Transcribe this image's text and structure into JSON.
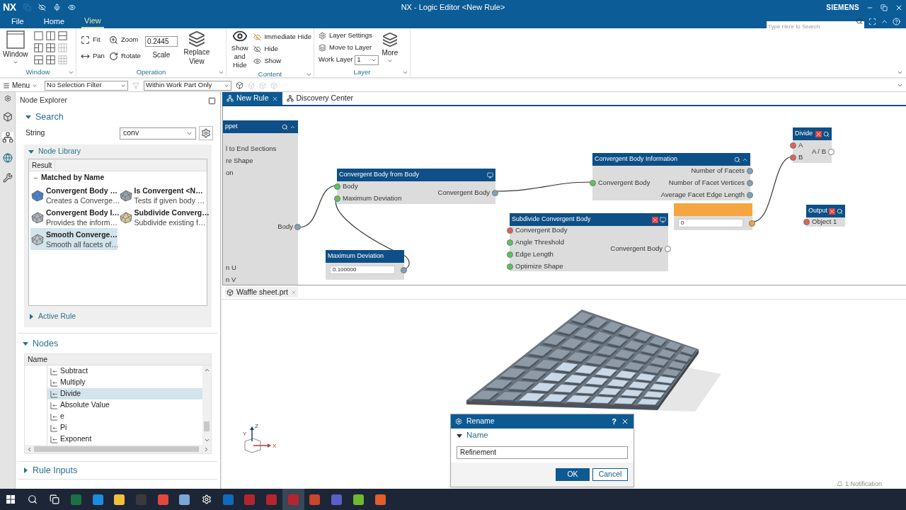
{
  "window": {
    "app": "NX",
    "title": "NX - Logic Editor <New Rule>",
    "brand": "SIEMENS",
    "search_placeholder": "Type Here to Search"
  },
  "menu_tabs": [
    {
      "label": "File",
      "selected": false
    },
    {
      "label": "Home",
      "selected": false
    },
    {
      "label": "View",
      "selected": true
    }
  ],
  "ribbon": {
    "window_group": {
      "label": "Window",
      "button": "Window"
    },
    "operation_group": {
      "label": "Operation",
      "fit": "Fit",
      "pan": "Pan",
      "zoom": "Zoom",
      "rotate": "Rotate",
      "scale_value": "0.2445",
      "scale_label": "Scale",
      "replace_view": "Replace View"
    },
    "content_group": {
      "label": "Content",
      "show_and_hide": "Show and Hide",
      "immediate_hide": "Immediate Hide",
      "hide": "Hide",
      "show": "Show"
    },
    "layer_group": {
      "label": "Layer",
      "layer_settings": "Layer Settings",
      "move_to_layer": "Move to Layer",
      "work_layer_label": "Work Layer",
      "work_layer_value": "1",
      "more": "More"
    }
  },
  "toolbar": {
    "menu": "Menu",
    "selection_filter": "No Selection Filter",
    "scope": "Within Work Part Only"
  },
  "node_explorer": {
    "title": "Node Explorer",
    "search": {
      "title": "Search",
      "expanded": true,
      "string_label": "String",
      "string_value": "conv"
    },
    "node_library": {
      "title": "Node Library",
      "expanded": true,
      "column": "Result",
      "group": "Matched by Name",
      "group_expanded": true,
      "results": [
        {
          "title": "Convergent Body …",
          "description": "Creates a Converge…",
          "selected": false
        },
        {
          "title": "Is Convergent <N…",
          "description": "Tests if given body …",
          "selected": false
        },
        {
          "title": "Convergent Body I…",
          "description": "Provides the inform…",
          "selected": false
        },
        {
          "title": "Subdivide Converg…",
          "description": "Subdivide existing f…",
          "selected": false
        },
        {
          "title": "Smooth Converge…",
          "description": "Smooth all facets of…",
          "selected": true
        }
      ]
    },
    "active_rule": {
      "title": "Active Rule",
      "expanded": false
    },
    "nodes": {
      "title": "Nodes",
      "expanded": true,
      "column": "Name",
      "items": [
        {
          "label": "Subtract",
          "selected": false
        },
        {
          "label": "Multiply",
          "selected": false
        },
        {
          "label": "Divide",
          "selected": true
        },
        {
          "label": "Absolute Value",
          "selected": false
        },
        {
          "label": "e",
          "selected": false
        },
        {
          "label": "Pi",
          "selected": false
        },
        {
          "label": "Exponent",
          "selected": false
        }
      ]
    },
    "rule_inputs": {
      "title": "Rule Inputs",
      "expanded": false
    }
  },
  "editor_tabs": [
    {
      "label": "New Rule",
      "selected": true
    },
    {
      "label": "Discovery Center",
      "selected": false
    }
  ],
  "graph": {
    "nodes": [
      {
        "kind": "clipped",
        "title": "ppet",
        "selected": false,
        "rows": [
          {
            "label": "l to End Sections",
            "kind": "input"
          },
          {
            "label": "re Shape",
            "kind": "input"
          },
          {
            "label": "on",
            "kind": "input"
          },
          {
            "label": "Body",
            "kind": "output"
          },
          {
            "label": "n U",
            "kind": "input"
          },
          {
            "label": "n V",
            "kind": "input"
          }
        ]
      },
      {
        "kind": "function",
        "title": "Convergent Body from Body",
        "selected": false,
        "inputs": [
          {
            "label": "Body",
            "kind": "ok"
          },
          {
            "label": "Maximum Deviation",
            "kind": "ok"
          }
        ],
        "outputs": [
          {
            "label": "Convergent Body",
            "kind": "out"
          }
        ]
      },
      {
        "kind": "value",
        "title": "Maximum Deviation",
        "selected": false,
        "value": "0.100000"
      },
      {
        "kind": "function",
        "title": "Convergent Body Information",
        "selected": false,
        "inputs": [
          {
            "label": "Convergent Body",
            "kind": "ok"
          }
        ],
        "outputs": [
          {
            "label": "Number of Facets",
            "kind": "out"
          },
          {
            "label": "Number of Facet Vertices",
            "kind": "out"
          },
          {
            "label": "Average Facet Edge Length",
            "kind": "out"
          }
        ]
      },
      {
        "kind": "function",
        "title": "Subdivide Convergent Body",
        "selected": false,
        "inputs": [
          {
            "label": "Convergent Body",
            "kind": "missing"
          },
          {
            "label": "Angle Threshold",
            "kind": "ok"
          },
          {
            "label": "Edge Length",
            "kind": "ok"
          },
          {
            "label": "Optimize Shape",
            "kind": "ok"
          }
        ],
        "outputs": [
          {
            "label": "Convergent Body",
            "kind": "open"
          }
        ]
      },
      {
        "kind": "value",
        "selected": true,
        "value": "0"
      },
      {
        "kind": "function",
        "title": "Divide",
        "selected": false,
        "inputs": [
          {
            "label": "A",
            "kind": "missing"
          },
          {
            "label": "B",
            "kind": "missing"
          }
        ],
        "outputs": [
          {
            "label": "A / B",
            "kind": "open"
          }
        ]
      },
      {
        "kind": "function",
        "title": "Output",
        "selected": false,
        "inputs": [
          {
            "label": "Object 1",
            "kind": "missing"
          }
        ]
      }
    ]
  },
  "viewport": {
    "tab": "Waffle sheet.prt",
    "axes": {
      "x": "X",
      "y": "Y",
      "z": "Z"
    },
    "notification": "1 Notification"
  },
  "dialog": {
    "title": "Rename",
    "help": "?",
    "section": "Name",
    "section_expanded": true,
    "value": "Refinement",
    "ok": "OK",
    "cancel": "Cancel"
  },
  "taskbar": [
    {
      "kind": "start",
      "selected": false
    },
    {
      "kind": "search",
      "selected": false
    },
    {
      "kind": "taskview",
      "selected": false
    },
    {
      "kind": "app",
      "color": "#1d7044",
      "selected": false
    },
    {
      "kind": "app",
      "color": "#1e8be0",
      "selected": false
    },
    {
      "kind": "app",
      "color": "#f0c03a",
      "selected": false
    },
    {
      "kind": "app",
      "color": "#3a3a3a",
      "selected": false
    },
    {
      "kind": "app",
      "color": "#e2483d",
      "selected": false
    },
    {
      "kind": "app",
      "color": "#7aa8d8",
      "selected": false
    },
    {
      "kind": "settings",
      "selected": false
    },
    {
      "kind": "app",
      "color": "#0f6cbd",
      "selected": false
    },
    {
      "kind": "app",
      "color": "#b3262e",
      "selected": false
    },
    {
      "kind": "app",
      "color": "#b3262e",
      "selected": false
    },
    {
      "kind": "app",
      "color": "#b3262e",
      "selected": true
    },
    {
      "kind": "app",
      "color": "#c8462b",
      "selected": false
    },
    {
      "kind": "app",
      "color": "#5b5fc7",
      "selected": false
    },
    {
      "kind": "app",
      "color": "#6fb931",
      "selected": false
    },
    {
      "kind": "app",
      "color": "#e35d2e",
      "selected": false
    }
  ]
}
